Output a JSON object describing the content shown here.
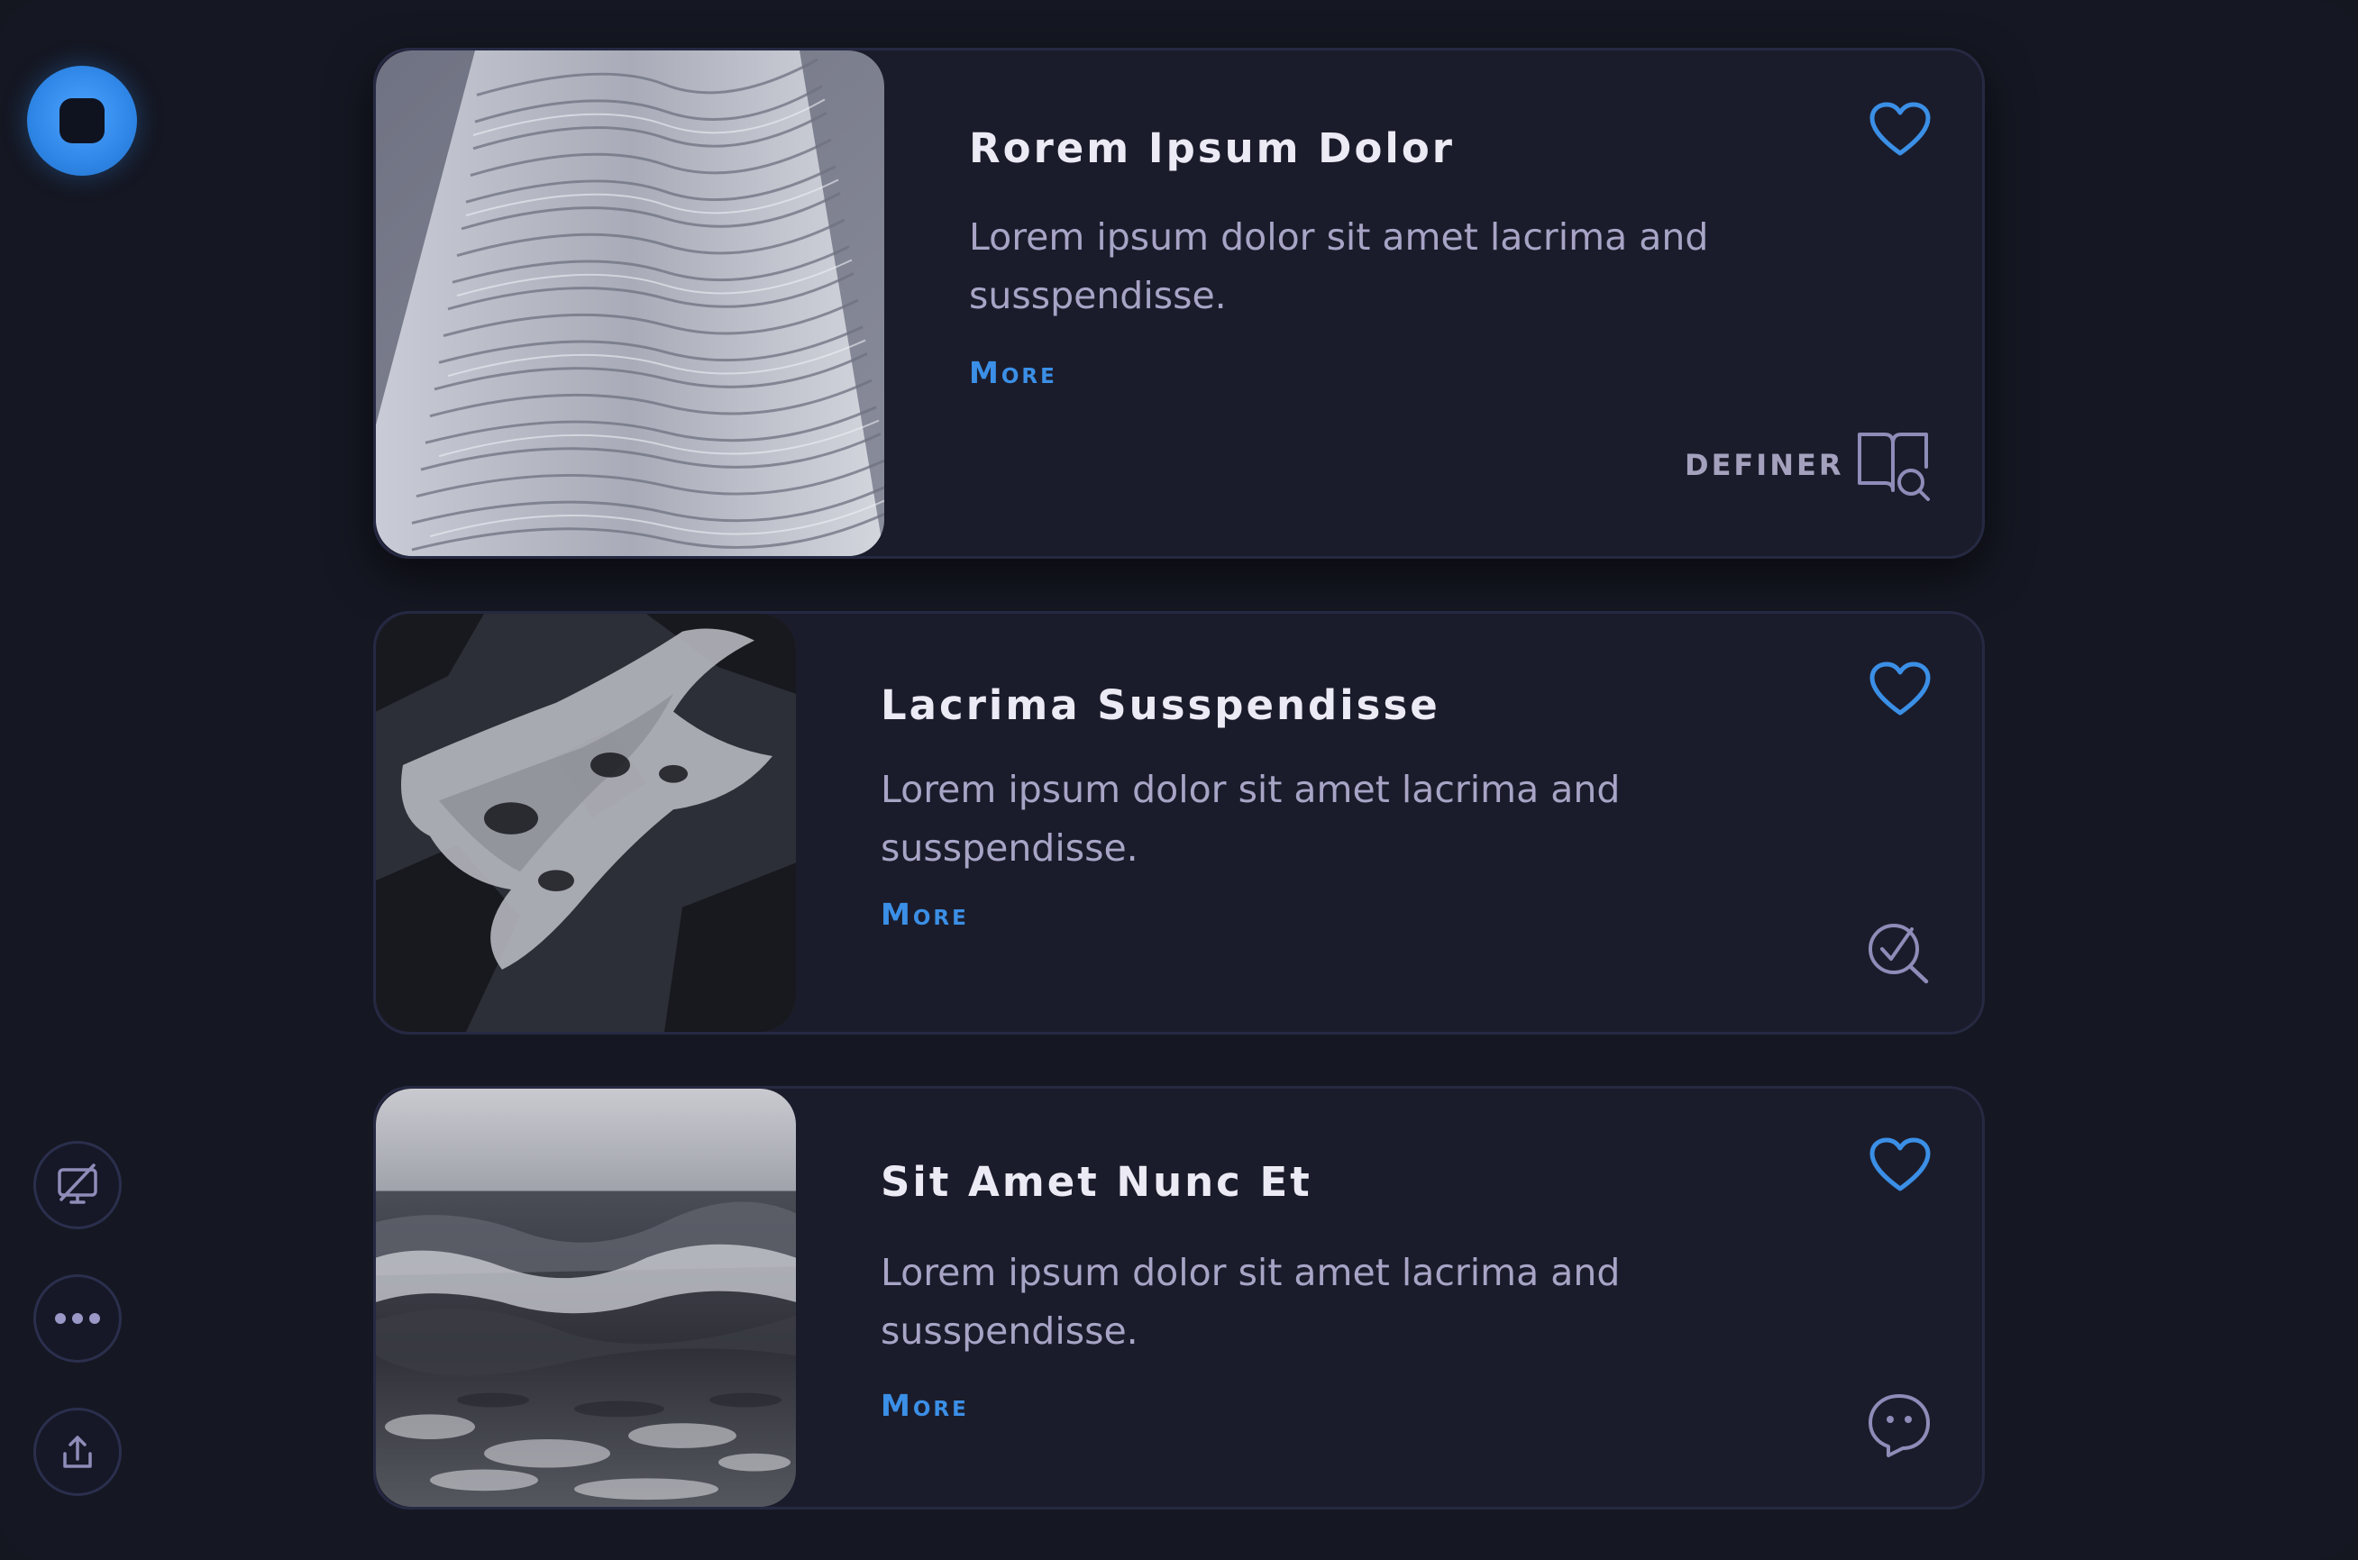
{
  "colors": {
    "background": "#151722",
    "card": "#1b1c2b",
    "card_border": "#262942",
    "accent": "#3b8fe6",
    "title": "#eceaf4",
    "body_text": "#a7a4c6",
    "icon_muted": "#8e8cb8"
  },
  "sidebar": {
    "logo_icon": "app-logo-icon",
    "buttons": [
      {
        "icon": "screen-off-icon"
      },
      {
        "icon": "more-dots-icon"
      },
      {
        "icon": "share-upload-icon"
      }
    ]
  },
  "cards": [
    {
      "image": "architecture-tower-photo",
      "title": "Rorem Ipsum Dolor",
      "description": "Lorem ipsum dolor sit amet lacrima and susspendisse.",
      "more_label": "More",
      "favorite_icon": "heart-icon",
      "action_label": "DEFINER",
      "action_icon": "book-search-icon"
    },
    {
      "image": "marble-texture-photo",
      "title": "Lacrima Susspendisse",
      "description": "Lorem ipsum dolor sit amet lacrima and susspendisse.",
      "more_label": "More",
      "favorite_icon": "heart-icon",
      "action_icon": "search-check-icon"
    },
    {
      "image": "ocean-wave-photo",
      "title": "Sit Amet Nunc Et",
      "description": "Lorem ipsum dolor sit amet lacrima and susspendisse.",
      "more_label": "More",
      "favorite_icon": "heart-icon",
      "action_icon": "ghost-chat-icon"
    }
  ]
}
